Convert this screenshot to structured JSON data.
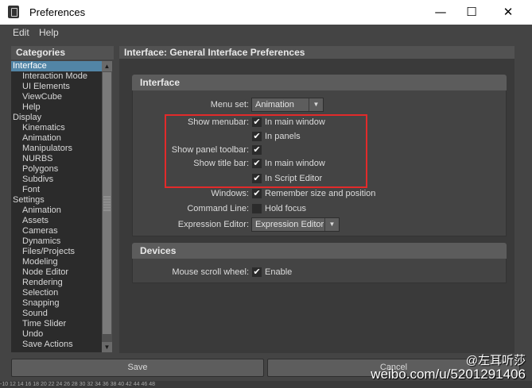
{
  "window": {
    "title": "Preferences",
    "minimize_glyph": "—",
    "maximize_glyph": "☐",
    "close_glyph": "✕"
  },
  "menubar": {
    "items": [
      "Edit",
      "Help"
    ]
  },
  "categories": {
    "header": "Categories",
    "items": [
      {
        "label": "Interface",
        "indent": 0,
        "selected": true
      },
      {
        "label": "Interaction Mode",
        "indent": 1
      },
      {
        "label": "UI Elements",
        "indent": 1
      },
      {
        "label": "ViewCube",
        "indent": 1
      },
      {
        "label": "Help",
        "indent": 1
      },
      {
        "label": "Display",
        "indent": 0
      },
      {
        "label": "Kinematics",
        "indent": 1
      },
      {
        "label": "Animation",
        "indent": 1
      },
      {
        "label": "Manipulators",
        "indent": 1
      },
      {
        "label": "NURBS",
        "indent": 1
      },
      {
        "label": "Polygons",
        "indent": 1
      },
      {
        "label": "Subdivs",
        "indent": 1
      },
      {
        "label": "Font",
        "indent": 1
      },
      {
        "label": "Settings",
        "indent": 0
      },
      {
        "label": "Animation",
        "indent": 1
      },
      {
        "label": "Assets",
        "indent": 1
      },
      {
        "label": "Cameras",
        "indent": 1
      },
      {
        "label": "Dynamics",
        "indent": 1
      },
      {
        "label": "Files/Projects",
        "indent": 1
      },
      {
        "label": "Modeling",
        "indent": 1
      },
      {
        "label": "Node Editor",
        "indent": 1
      },
      {
        "label": "Rendering",
        "indent": 1
      },
      {
        "label": "Selection",
        "indent": 1
      },
      {
        "label": "Snapping",
        "indent": 1
      },
      {
        "label": "Sound",
        "indent": 1
      },
      {
        "label": "Time Slider",
        "indent": 1
      },
      {
        "label": "Undo",
        "indent": 1
      },
      {
        "label": "Save Actions",
        "indent": 1
      }
    ],
    "scroll_up_glyph": "▲",
    "scroll_down_glyph": "▼"
  },
  "main": {
    "header": "Interface: General Interface Preferences",
    "interface_section": {
      "title": "Interface",
      "menu_set_label": "Menu set:",
      "menu_set_value": "Animation",
      "show_menubar_label": "Show menubar:",
      "show_menubar_main": "In main window",
      "show_menubar_panels": "In panels",
      "show_panel_toolbar_label": "Show panel toolbar:",
      "show_title_bar_label": "Show title bar:",
      "show_title_bar_main": "In main window",
      "show_title_bar_script": "In Script Editor",
      "windows_label": "Windows:",
      "windows_value": "Remember size and position",
      "command_line_label": "Command Line:",
      "command_line_value": "Hold focus",
      "expression_editor_label": "Expression Editor:",
      "expression_editor_value": "Expression Editor"
    },
    "devices_section": {
      "title": "Devices",
      "mouse_scroll_label": "Mouse scroll wheel:",
      "mouse_scroll_value": "Enable"
    },
    "check_glyph": "✔",
    "dropdown_glyph": "▼"
  },
  "buttons": {
    "save": "Save",
    "cancel": "Cancel"
  },
  "ruler": {
    "ticks": "-10    12    14    16    18    20    22    24    26    28    30    32    34    36    38    40    42    44    46    48"
  },
  "watermark": {
    "handle": "@左耳听莎",
    "url": "weibo.com/u/5201291406"
  },
  "colors": {
    "selection": "#5285a6",
    "highlight_box": "#e22a2a",
    "window_bg": "#444444"
  }
}
